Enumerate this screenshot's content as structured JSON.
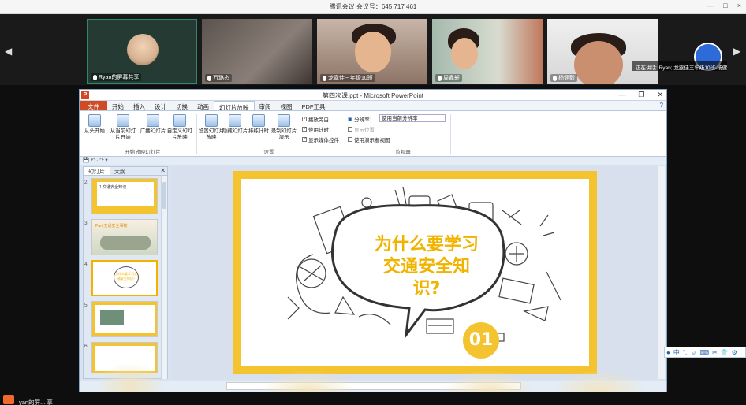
{
  "meeting": {
    "title": "腾讯会议 会议号：645 717 461",
    "controls": [
      "—",
      "□",
      "×"
    ],
    "speaking": "正在讲话: Ryan; 龙露佳三年级10班-杨健毅",
    "participants": [
      {
        "name": "Ryan的屏幕共享"
      },
      {
        "name": "万璐杰"
      },
      {
        "name": "龙露佳三年级10班"
      },
      {
        "name": "周鑫轩"
      },
      {
        "name": "杨健毅"
      }
    ],
    "prev_arrow": "◀",
    "next_arrow": "▶"
  },
  "ppt": {
    "title": "第四次课.ppt - Microsoft PowerPoint",
    "app_letter": "P",
    "window_controls": [
      "—",
      "❐",
      "✕"
    ],
    "tabs": [
      "文件",
      "开始",
      "插入",
      "设计",
      "切换",
      "动画",
      "幻灯片放映",
      "审阅",
      "视图",
      "PDF工具"
    ],
    "active_tab": "幻灯片放映",
    "help": "? ",
    "ribbon": {
      "buttons": [
        {
          "label": "从头开始"
        },
        {
          "label": "从当前幻灯片开始"
        },
        {
          "label": "广播幻灯片"
        },
        {
          "label": "自定义幻灯片放映"
        },
        {
          "label": "设置幻灯片放映"
        },
        {
          "label": "隐藏幻灯片"
        },
        {
          "label": "排练计时"
        },
        {
          "label": "录制幻灯片演示"
        }
      ],
      "groups": [
        "开始放映幻灯片",
        "设置",
        "监视器"
      ],
      "checkboxes": [
        {
          "label": "播放旁白",
          "checked": "✓"
        },
        {
          "label": "使用计时",
          "checked": "✓"
        },
        {
          "label": "显示媒体控件",
          "checked": "✓"
        },
        {
          "label": "显示位置",
          "checked": ""
        },
        {
          "label": "使用演示者视图",
          "checked": ""
        }
      ],
      "resolution_label": "分辨率：",
      "resolution_value": "使用当前分辨率"
    },
    "quick_access": "💾 ↶ · ↷ ▾",
    "slides_pane": {
      "tabs": [
        "幻灯片",
        "大纲"
      ],
      "close": "✕",
      "thumbs": [
        {
          "num": "2",
          "text": "1.交通安全知识"
        },
        {
          "num": "3",
          "text": "Part 交通安全事故"
        },
        {
          "num": "4",
          "text": "为什么要学习交通安全知识?"
        },
        {
          "num": "5",
          "text": ""
        },
        {
          "num": "6",
          "text": ""
        }
      ]
    },
    "slide": {
      "title": "为什么要学习交通安全知识?",
      "number": "01"
    }
  },
  "ime": {
    "items": [
      "中",
      "°,",
      "☺",
      "⌨",
      "✂",
      "👕",
      "⚙"
    ]
  },
  "bottom": {
    "label": "yan的屏... 享"
  }
}
